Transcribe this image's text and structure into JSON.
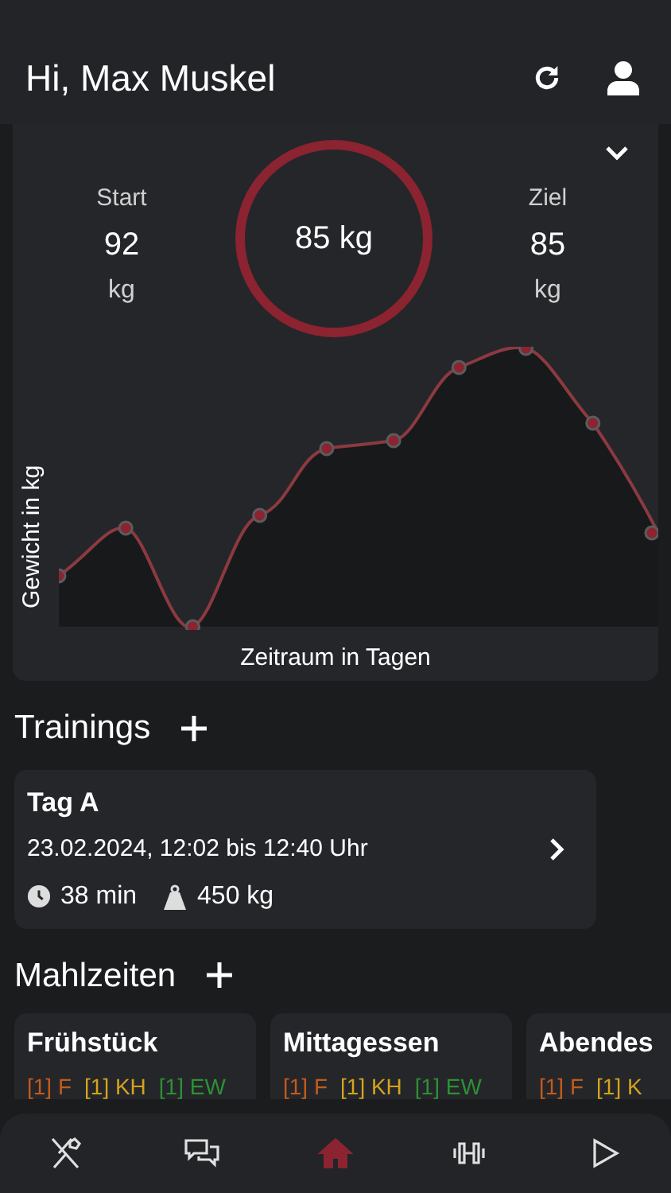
{
  "header": {
    "title": "Hi, Max Muskel"
  },
  "weight": {
    "start_label": "Start",
    "start_value": "92",
    "start_unit": "kg",
    "current": "85 kg",
    "goal_label": "Ziel",
    "goal_value": "85",
    "goal_unit": "kg",
    "ylabel": "Gewicht in kg",
    "xlabel": "Zeitraum in Tagen"
  },
  "trainings": {
    "title": "Trainings",
    "items": [
      {
        "name": "Tag A",
        "time": "23.02.2024, 12:02 bis 12:40 Uhr",
        "duration": "38 min",
        "volume": "450 kg"
      }
    ]
  },
  "meals": {
    "title": "Mahlzeiten",
    "items": [
      {
        "name": "Frühstück",
        "tags": [
          {
            "count": "[1]",
            "label": "F",
            "color": "#c45a1c"
          },
          {
            "count": "[1]",
            "label": "KH",
            "color": "#d6a21e"
          },
          {
            "count": "[1]",
            "label": "EW",
            "color": "#2f8f35"
          }
        ]
      },
      {
        "name": "Mittagessen",
        "tags": [
          {
            "count": "[1]",
            "label": "F",
            "color": "#c45a1c"
          },
          {
            "count": "[1]",
            "label": "KH",
            "color": "#d6a21e"
          },
          {
            "count": "[1]",
            "label": "EW",
            "color": "#2f8f35"
          }
        ]
      },
      {
        "name": "Abendes",
        "tags": [
          {
            "count": "[1]",
            "label": "F",
            "color": "#c45a1c"
          },
          {
            "count": "[1]",
            "label": "K",
            "color": "#d6a21e"
          }
        ]
      }
    ]
  },
  "nav": [
    {
      "kind": "cutlery",
      "selected": false
    },
    {
      "kind": "chat",
      "selected": false
    },
    {
      "kind": "home",
      "selected": true
    },
    {
      "kind": "dumbbell",
      "selected": false
    },
    {
      "kind": "play",
      "selected": false
    }
  ]
}
